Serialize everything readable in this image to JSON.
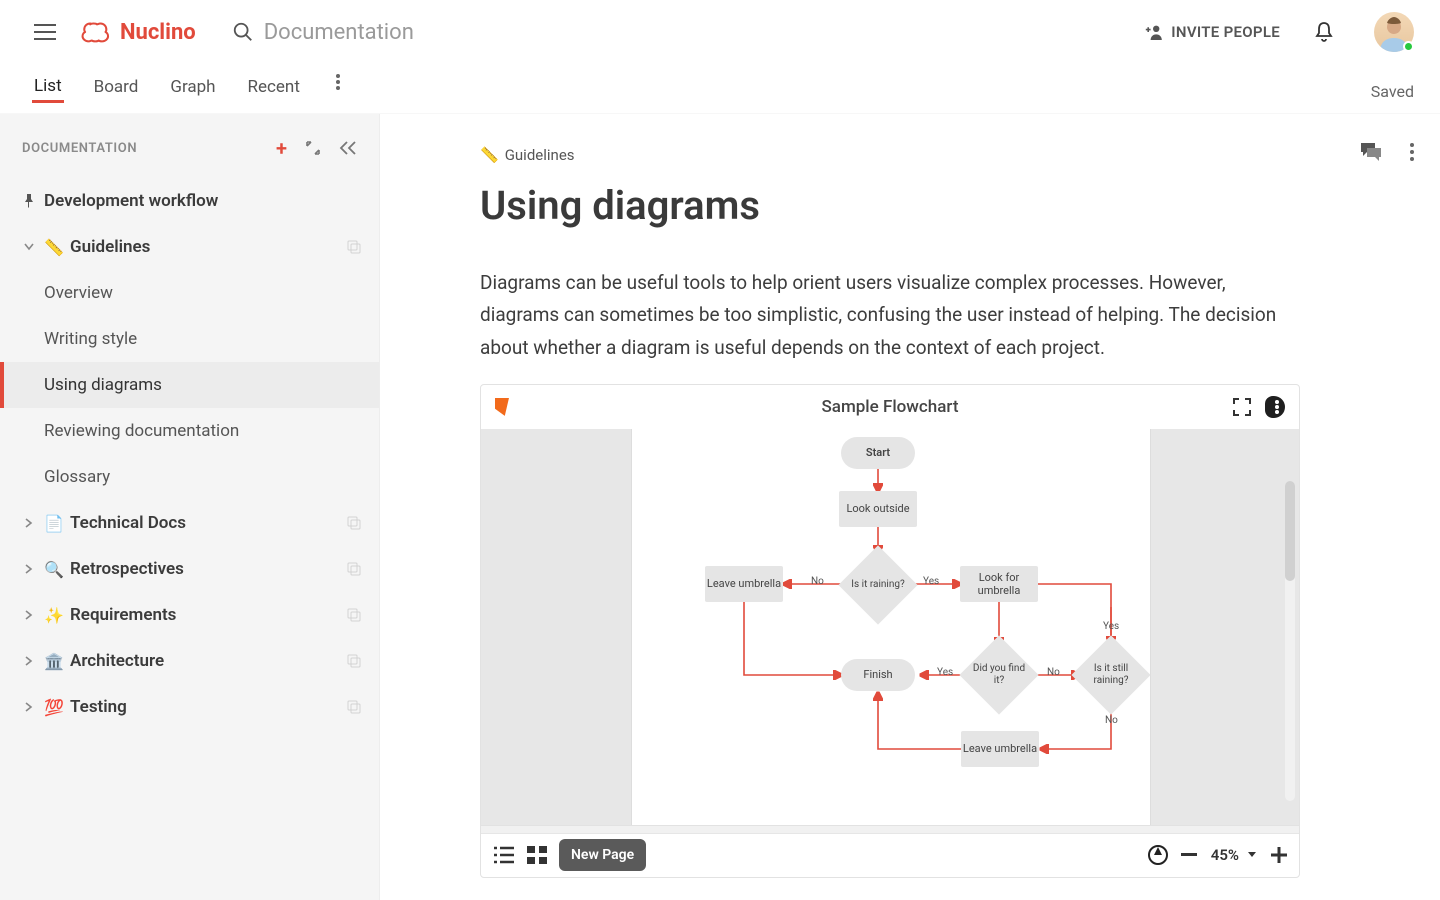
{
  "topbar": {
    "brand": "Nuclino",
    "search_placeholder": "Documentation",
    "invite_label": "INVITE PEOPLE"
  },
  "viewbar": {
    "tabs": [
      "List",
      "Board",
      "Graph",
      "Recent"
    ],
    "active_index": 0,
    "saved_label": "Saved"
  },
  "sidebar": {
    "title": "DOCUMENTATION",
    "pinned": {
      "label": "Development workflow"
    },
    "sections": [
      {
        "emoji": "📏",
        "label": "Guidelines",
        "expanded": true,
        "children": [
          "Overview",
          "Writing style",
          "Using diagrams",
          "Reviewing documentation",
          "Glossary"
        ],
        "selected_index": 2
      },
      {
        "emoji": "📄",
        "label": "Technical Docs"
      },
      {
        "emoji": "🔍",
        "label": "Retrospectives"
      },
      {
        "emoji": "✨",
        "label": "Requirements"
      },
      {
        "emoji": "🏛️",
        "label": "Architecture"
      },
      {
        "emoji": "💯",
        "label": "Testing"
      }
    ]
  },
  "document": {
    "breadcrumb_emoji": "📏",
    "breadcrumb": "Guidelines",
    "title": "Using diagrams",
    "paragraph": "Diagrams can be useful tools to help orient users visualize complex processes. However, diagrams can sometimes be too simplistic, confusing the user instead of helping. The decision about whether a diagram is useful depends on the context of each project."
  },
  "embed": {
    "title": "Sample Flowchart",
    "page_button": "New Page",
    "zoom_pct": "45%",
    "flow": {
      "start": "Start",
      "look_outside": "Look outside",
      "is_raining": "Is it raining?",
      "leave_umbrella": "Leave umbrella",
      "look_for_umbrella": "Look for umbrella",
      "did_find": "Did you find it?",
      "still_raining": "Is it still raining?",
      "finish": "Finish",
      "labels": {
        "no": "No",
        "yes": "Yes"
      }
    }
  }
}
